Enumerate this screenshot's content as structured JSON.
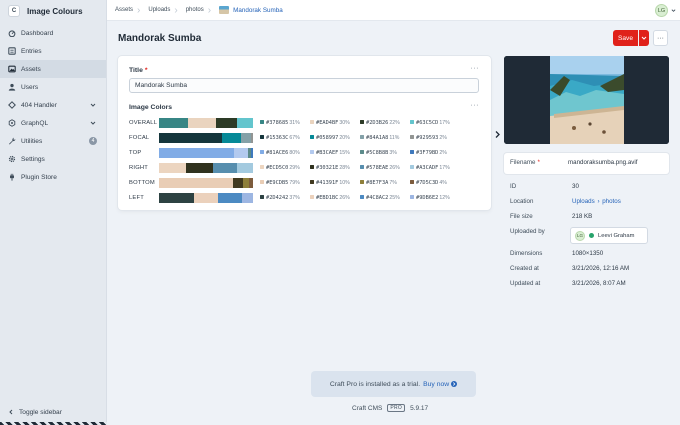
{
  "site": {
    "icon_letter": "C",
    "name": "Image Colours"
  },
  "nav": [
    {
      "label": "Dashboard",
      "icon": "dashboard-icon"
    },
    {
      "label": "Entries",
      "icon": "entries-icon"
    },
    {
      "label": "Assets",
      "icon": "assets-icon",
      "active": true
    },
    {
      "label": "Users",
      "icon": "users-icon"
    },
    {
      "label": "404 Handler",
      "icon": "handler-icon",
      "expandable": true
    },
    {
      "label": "GraphQL",
      "icon": "graphql-icon",
      "expandable": true
    },
    {
      "label": "Utilities",
      "icon": "utilities-icon",
      "badge": "4"
    },
    {
      "label": "Settings",
      "icon": "gear-icon"
    },
    {
      "label": "Plugin Store",
      "icon": "plug-icon"
    }
  ],
  "toggle_sidebar": "Toggle sidebar",
  "breadcrumbs": [
    "Assets",
    "Uploads",
    "photos"
  ],
  "breadcrumb_current": "Mandorak Sumba",
  "user_initials": "LG",
  "page_title": "Mandorak Sumba",
  "actions": {
    "save": "Save",
    "more": "···"
  },
  "title_field": {
    "label": "Title",
    "value": "Mandorak Sumba"
  },
  "colors_field": {
    "label": "Image Colors",
    "rows": [
      {
        "label": "OVERALL",
        "segments": [
          [
            "#378685",
            31
          ],
          [
            "#EAD4BF",
            30
          ],
          [
            "#2D3B26",
            22
          ],
          [
            "#63C5CD",
            17
          ]
        ],
        "swatches": [
          [
            "#378685",
            "31%"
          ],
          [
            "#EAD4BF",
            "30%"
          ],
          [
            "#2D3B26",
            "22%"
          ],
          [
            "#63C5CD",
            "17%"
          ]
        ]
      },
      {
        "label": "FOCAL",
        "segments": [
          [
            "#15363C",
            67
          ],
          [
            "#058997",
            20
          ],
          [
            "#84A1A8",
            11
          ],
          [
            "#929593",
            2
          ]
        ],
        "swatches": [
          [
            "#15363C",
            "67%"
          ],
          [
            "#058997",
            "20%"
          ],
          [
            "#84A1A8",
            "11%"
          ],
          [
            "#929593",
            "2%"
          ]
        ]
      },
      {
        "label": "TOP",
        "segments": [
          [
            "#81ACE6",
            80
          ],
          [
            "#B3CAEF",
            15
          ],
          [
            "#5C8B8B",
            3
          ],
          [
            "#3F79BD",
            2
          ]
        ],
        "swatches": [
          [
            "#81ACE6",
            "80%"
          ],
          [
            "#B3CAEF",
            "15%"
          ],
          [
            "#5C8B8B",
            "3%"
          ],
          [
            "#3F79BD",
            "2%"
          ]
        ]
      },
      {
        "label": "RIGHT",
        "segments": [
          [
            "#ECD5C0",
            29
          ],
          [
            "#30321E",
            28
          ],
          [
            "#578EAE",
            26
          ],
          [
            "#A3CADF",
            17
          ]
        ],
        "swatches": [
          [
            "#ECD5C0",
            "29%"
          ],
          [
            "#30321E",
            "28%"
          ],
          [
            "#578EAE",
            "26%"
          ],
          [
            "#A3CADF",
            "17%"
          ]
        ]
      },
      {
        "label": "BOTTOM",
        "segments": [
          [
            "#E9CDB5",
            79
          ],
          [
            "#41391F",
            10
          ],
          [
            "#8E7F3A",
            7
          ],
          [
            "#7D5C3D",
            4
          ]
        ],
        "swatches": [
          [
            "#E9CDB5",
            "79%"
          ],
          [
            "#41391F",
            "10%"
          ],
          [
            "#8E7F3A",
            "7%"
          ],
          [
            "#7D5C3D",
            "4%"
          ]
        ]
      },
      {
        "label": "LEFT",
        "segments": [
          [
            "#2D4242",
            37
          ],
          [
            "#EBD1BC",
            26
          ],
          [
            "#4C8AC2",
            25
          ],
          [
            "#9DB6E2",
            12
          ]
        ],
        "swatches": [
          [
            "#2D4242",
            "37%"
          ],
          [
            "#EBD1BC",
            "26%"
          ],
          [
            "#4C8AC2",
            "25%"
          ],
          [
            "#9DB6E2",
            "12%"
          ]
        ]
      }
    ]
  },
  "details": {
    "filename_label": "Filename",
    "filename": "mandoraksumba.png.avif",
    "id_label": "ID",
    "id": "30",
    "location_label": "Location",
    "location_root": "Uploads",
    "location_folder": "photos",
    "filesize_label": "File size",
    "filesize": "218 KB",
    "uploaded_by_label": "Uploaded by",
    "uploader_initials": "LG",
    "uploader": "Leevi Graham",
    "dimensions_label": "Dimensions",
    "dimensions": "1080×1350",
    "created_label": "Created at",
    "created": "3/21/2026, 12:16 AM",
    "updated_label": "Updated at",
    "updated": "3/21/2026, 8:07 AM"
  },
  "trial": {
    "text": "Craft Pro is installed as a trial.",
    "link": "Buy now"
  },
  "footer": {
    "cms": "Craft CMS",
    "edition": "PRO",
    "version": "5.9.17"
  }
}
